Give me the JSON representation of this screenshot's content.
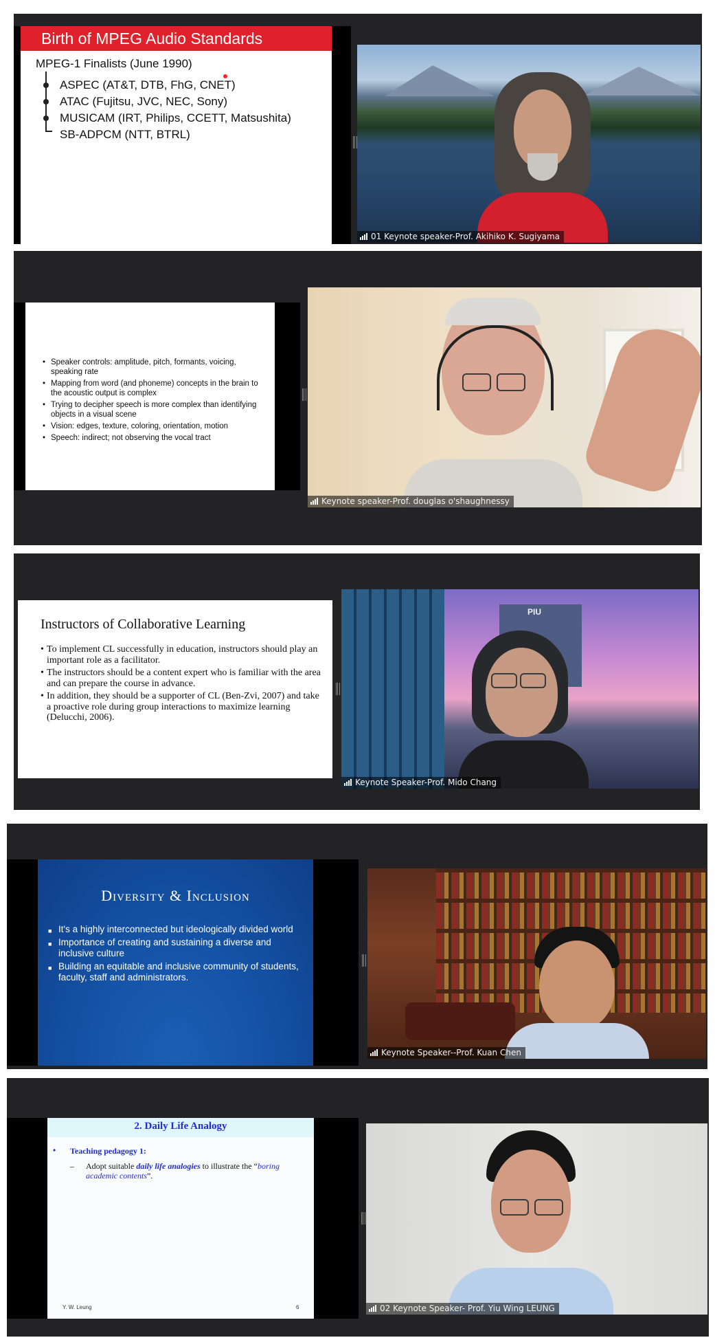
{
  "panel1": {
    "slide_title": "Birth of MPEG Audio Standards",
    "subtitle": "MPEG-1 Finalists (June 1990)",
    "items": [
      "ASPEC (AT&T, DTB, FhG, CNET)",
      "ATAC (Fujitsu, JVC, NEC, Sony)",
      "MUSICAM (IRT, Philips, CCETT, Matsushita)",
      "SB-ADPCM (NTT, BTRL)"
    ],
    "speaker": "01 Keynote speaker-Prof. Akihiko K. Sugiyama"
  },
  "panel2": {
    "bullets": [
      "Speaker controls: amplitude, pitch, formants, voicing, speaking rate",
      "Mapping from word (and phoneme) concepts in the brain to the acoustic output is complex",
      "Trying to decipher speech is more complex than identifying objects in a visual scene",
      "Vision: edges, texture, coloring, orientation, motion",
      "Speech: indirect; not observing the vocal tract"
    ],
    "speaker": "Keynote speaker-Prof. douglas o'shaughnessy"
  },
  "panel3": {
    "slide_title": "Instructors of Collaborative Learning",
    "bullets": [
      "To implement CL successfully in education, instructors should play an important role as a facilitator.",
      "The instructors should be a content expert who is familiar with the area and can prepare the course in advance.",
      "In addition, they should be a supporter of CL (Ben-Zvi, 2007) and take a proactive role during group interactions to maximize learning (Delucchi, 2006)."
    ],
    "building_sign": "PIU",
    "speaker": "Keynote Speaker-Prof. Mido Chang"
  },
  "panel4": {
    "slide_title": "Diversity & Inclusion",
    "bullets": [
      "It's a highly interconnected but ideologically divided world",
      "Importance of creating and sustaining a diverse and inclusive culture",
      "Building an equitable and inclusive community of students, faculty, staff and administrators."
    ],
    "speaker": "Keynote Speaker--Prof. Kuan Chen"
  },
  "panel5": {
    "slide_title": "2. Daily Life Analogy",
    "bullet": "Teaching pedagogy 1:",
    "sub_prefix": "Adopt suitable ",
    "sub_emph": "daily life analogies",
    "sub_mid": " to illustrate the “",
    "sub_quote": "boring academic contents",
    "sub_end": "”.",
    "footer_author": "Y. W. Leung",
    "footer_page": "6",
    "speaker": "02 Keynote Speaker- Prof. Yiu Wing LEUNG"
  },
  "colors": {
    "panel_bg": "#232325",
    "mpeg_red": "#e0202a",
    "diversity_blue": "#1a5fbf",
    "analogy_header_bg": "#dff6fb",
    "analogy_blue": "#1e2bd6"
  }
}
